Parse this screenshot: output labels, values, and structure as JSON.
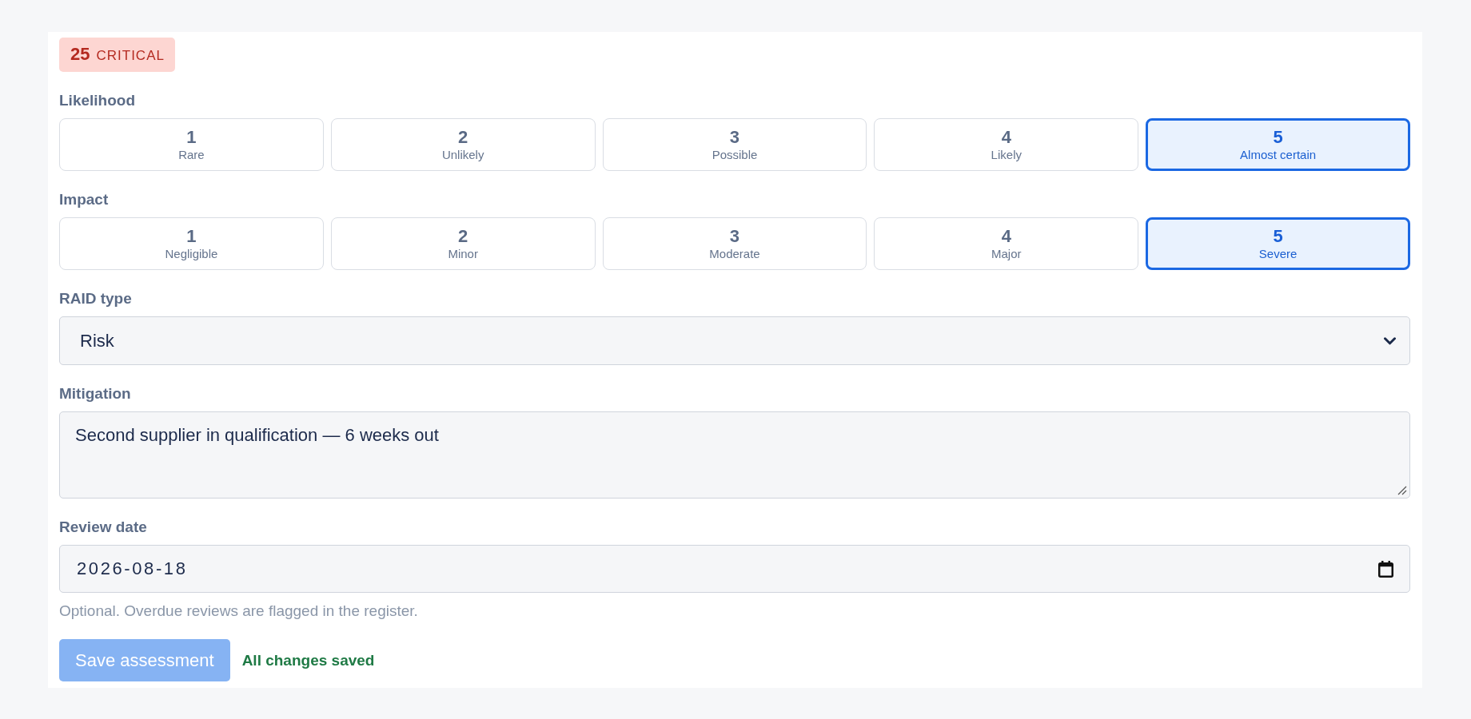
{
  "risk_badge": {
    "score": "25",
    "level": "CRITICAL"
  },
  "likelihood": {
    "label": "Likelihood",
    "options": [
      {
        "value": "1",
        "name": "Rare",
        "selected": false
      },
      {
        "value": "2",
        "name": "Unlikely",
        "selected": false
      },
      {
        "value": "3",
        "name": "Possible",
        "selected": false
      },
      {
        "value": "4",
        "name": "Likely",
        "selected": false
      },
      {
        "value": "5",
        "name": "Almost certain",
        "selected": true
      }
    ]
  },
  "impact": {
    "label": "Impact",
    "options": [
      {
        "value": "1",
        "name": "Negligible",
        "selected": false
      },
      {
        "value": "2",
        "name": "Minor",
        "selected": false
      },
      {
        "value": "3",
        "name": "Moderate",
        "selected": false
      },
      {
        "value": "4",
        "name": "Major",
        "selected": false
      },
      {
        "value": "5",
        "name": "Severe",
        "selected": true
      }
    ]
  },
  "raid_type": {
    "label": "RAID type",
    "value": "Risk"
  },
  "mitigation": {
    "label": "Mitigation",
    "value": "Second supplier in qualification — 6 weeks out"
  },
  "review_date": {
    "label": "Review date",
    "value": "2026-08-18",
    "help": "Optional. Overdue reviews are flagged in the register."
  },
  "save_button": {
    "label": "Save assessment",
    "disabled": true
  },
  "save_status": "All changes saved"
}
